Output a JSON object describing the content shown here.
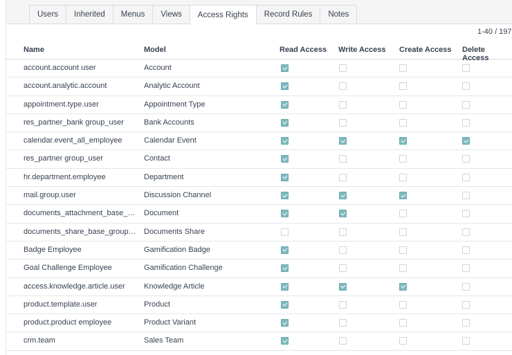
{
  "tabs": [
    {
      "label": "Users",
      "active": false
    },
    {
      "label": "Inherited",
      "active": false
    },
    {
      "label": "Menus",
      "active": false
    },
    {
      "label": "Views",
      "active": false
    },
    {
      "label": "Access Rights",
      "active": true
    },
    {
      "label": "Record Rules",
      "active": false
    },
    {
      "label": "Notes",
      "active": false
    }
  ],
  "pager": {
    "text": "1-40 / 197"
  },
  "columns": {
    "name": "Name",
    "model": "Model",
    "read": "Read Access",
    "write": "Write Access",
    "create": "Create Access",
    "delete": "Delete Access"
  },
  "rows": [
    {
      "name": "account.account user",
      "model": "Account",
      "read": true,
      "write": false,
      "create": false,
      "delete": false
    },
    {
      "name": "account.analytic.account",
      "model": "Analytic Account",
      "read": true,
      "write": false,
      "create": false,
      "delete": false
    },
    {
      "name": "appointment.type.user",
      "model": "Appointment Type",
      "read": true,
      "write": false,
      "create": false,
      "delete": false
    },
    {
      "name": "res_partner_bank group_user",
      "model": "Bank Accounts",
      "read": true,
      "write": false,
      "create": false,
      "delete": false
    },
    {
      "name": "calendar.event_all_employee",
      "model": "Calendar Event",
      "read": true,
      "write": true,
      "create": true,
      "delete": true
    },
    {
      "name": "res_partner group_user",
      "model": "Contact",
      "read": true,
      "write": false,
      "create": false,
      "delete": false
    },
    {
      "name": "hr.department.employee",
      "model": "Department",
      "read": true,
      "write": false,
      "create": false,
      "delete": false
    },
    {
      "name": "mail.group.user",
      "model": "Discussion Channel",
      "read": true,
      "write": true,
      "create": true,
      "delete": false
    },
    {
      "name": "documents_attachment_base_gro...",
      "model": "Document",
      "read": true,
      "write": true,
      "create": false,
      "delete": false
    },
    {
      "name": "documents_share_base_group_user",
      "model": "Documents Share",
      "read": false,
      "write": false,
      "create": false,
      "delete": false
    },
    {
      "name": "Badge Employee",
      "model": "Gamification Badge",
      "read": true,
      "write": false,
      "create": false,
      "delete": false
    },
    {
      "name": "Goal Challenge Employee",
      "model": "Gamification Challenge",
      "read": true,
      "write": false,
      "create": false,
      "delete": false
    },
    {
      "name": "access.knowledge.article.user",
      "model": "Knowledge Article",
      "read": true,
      "write": true,
      "create": true,
      "delete": false
    },
    {
      "name": "product.template.user",
      "model": "Product",
      "read": true,
      "write": false,
      "create": false,
      "delete": false
    },
    {
      "name": "product.product employee",
      "model": "Product Variant",
      "read": true,
      "write": false,
      "create": false,
      "delete": false
    },
    {
      "name": "crm.team",
      "model": "Sales Team",
      "read": true,
      "write": false,
      "create": false,
      "delete": false
    }
  ],
  "colors": {
    "checked": "#7fb9be",
    "tab_bg": "#f5f5f5"
  }
}
